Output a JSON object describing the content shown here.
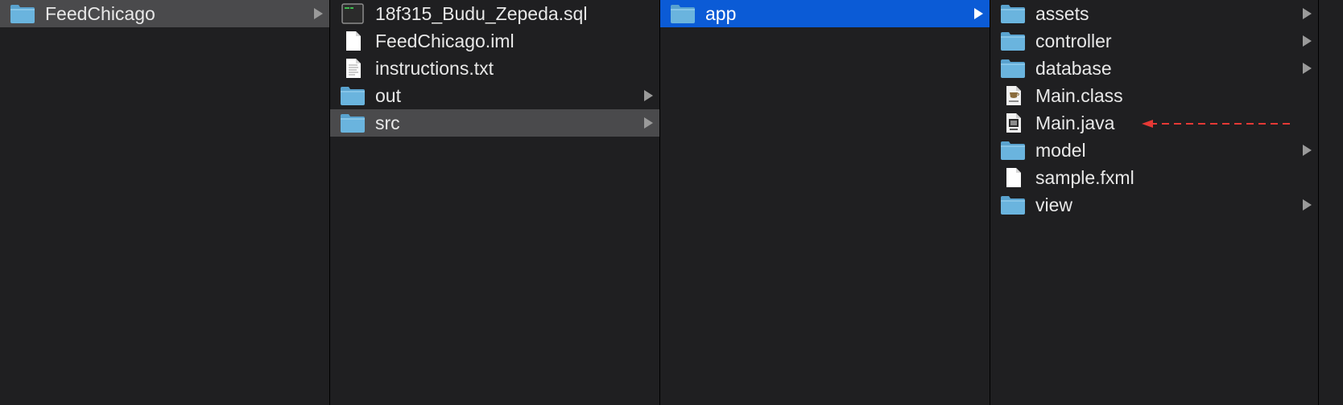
{
  "columns": {
    "col1": {
      "items": [
        {
          "label": "FeedChicago",
          "icon": "folder-icon",
          "selected": "gray"
        }
      ]
    },
    "col2": {
      "items": [
        {
          "label": "18f315_Budu_Zepeda.sql",
          "icon": "sql-file-icon"
        },
        {
          "label": "FeedChicago.iml",
          "icon": "document-icon"
        },
        {
          "label": "instructions.txt",
          "icon": "text-file-icon"
        },
        {
          "label": "out",
          "icon": "folder-icon"
        },
        {
          "label": "src",
          "icon": "folder-icon",
          "selected": "gray"
        }
      ]
    },
    "col3": {
      "items": [
        {
          "label": "app",
          "icon": "folder-icon",
          "selected": "blue"
        }
      ]
    },
    "col4": {
      "items": [
        {
          "label": "assets",
          "icon": "folder-icon"
        },
        {
          "label": "controller",
          "icon": "folder-icon"
        },
        {
          "label": "database",
          "icon": "folder-icon"
        },
        {
          "label": "Main.class",
          "icon": "class-file-icon"
        },
        {
          "label": "Main.java",
          "icon": "java-file-icon"
        },
        {
          "label": "model",
          "icon": "folder-icon"
        },
        {
          "label": "sample.fxml",
          "icon": "document-icon"
        },
        {
          "label": "view",
          "icon": "folder-icon"
        }
      ]
    },
    "col5": {
      "items": []
    }
  },
  "colors": {
    "background": "#1f1f21",
    "selection_gray": "#4a4a4c",
    "selection_blue": "#0b5bd6",
    "annotation_arrow": "#e53935"
  }
}
